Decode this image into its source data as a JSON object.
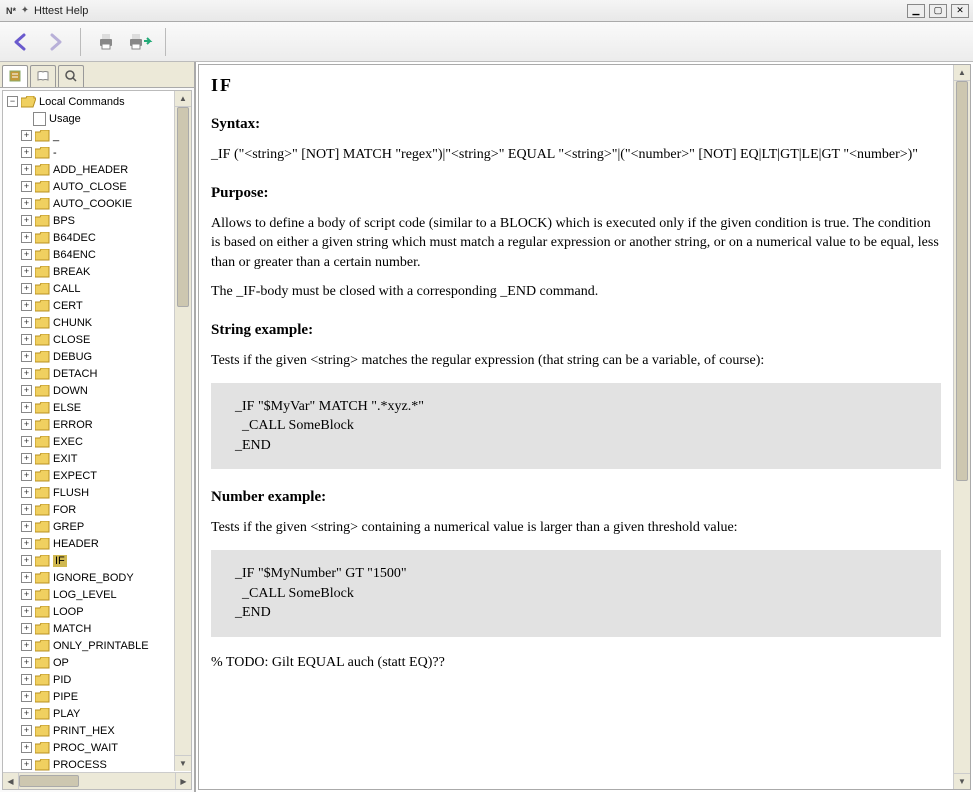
{
  "window": {
    "app_icon_text": "N*",
    "title": "Httest Help"
  },
  "toolbar": {
    "back": "back-arrow-icon",
    "forward": "forward-arrow-icon",
    "print": "print-icon",
    "print_preview": "print-preview-icon"
  },
  "sidebar": {
    "tabs": {
      "contents": "contents-tab",
      "index": "index-tab",
      "search": "search-tab"
    },
    "root": {
      "label": "Local Commands",
      "expanded": true
    },
    "usage": {
      "label": "Usage"
    },
    "items": [
      {
        "label": "_"
      },
      {
        "label": "-"
      },
      {
        "label": "ADD_HEADER"
      },
      {
        "label": "AUTO_CLOSE"
      },
      {
        "label": "AUTO_COOKIE"
      },
      {
        "label": "BPS"
      },
      {
        "label": "B64DEC"
      },
      {
        "label": "B64ENC"
      },
      {
        "label": "BREAK"
      },
      {
        "label": "CALL"
      },
      {
        "label": "CERT"
      },
      {
        "label": "CHUNK"
      },
      {
        "label": "CLOSE"
      },
      {
        "label": "DEBUG"
      },
      {
        "label": "DETACH"
      },
      {
        "label": "DOWN"
      },
      {
        "label": "ELSE"
      },
      {
        "label": "ERROR"
      },
      {
        "label": "EXEC"
      },
      {
        "label": "EXIT"
      },
      {
        "label": "EXPECT"
      },
      {
        "label": "FLUSH"
      },
      {
        "label": "FOR"
      },
      {
        "label": "GREP"
      },
      {
        "label": "HEADER"
      },
      {
        "label": "IF",
        "selected": true
      },
      {
        "label": "IGNORE_BODY"
      },
      {
        "label": "LOG_LEVEL"
      },
      {
        "label": "LOOP"
      },
      {
        "label": "MATCH"
      },
      {
        "label": "ONLY_PRINTABLE"
      },
      {
        "label": "OP"
      },
      {
        "label": "PID"
      },
      {
        "label": "PIPE"
      },
      {
        "label": "PLAY"
      },
      {
        "label": "PRINT_HEX"
      },
      {
        "label": "PROC_WAIT"
      },
      {
        "label": "PROCESS"
      }
    ]
  },
  "doc": {
    "title": "IF",
    "syntax_h": "Syntax:",
    "syntax_body": "_IF (\"<string>\" [NOT] MATCH \"regex\")|\"<string>\" EQUAL \"<string>\"|(\"<number>\" [NOT] EQ|LT|GT|LE|GT \"<number>)\"",
    "purpose_h": "Purpose:",
    "purpose_p1": "Allows to define a body of script code (similar to a BLOCK) which is executed only if the given condition is true. The condition is based on either a given string which must match a regular expression or another string, or on a numerical value to be equal, less than or greater than a certain number.",
    "purpose_p2": "The _IF-body must be closed with a corresponding _END command.",
    "string_h": "String example:",
    "string_p": "Tests if the given <string> matches the regular expression (that string can be a variable, of course):",
    "string_code": "_IF \"$MyVar\" MATCH \".*xyz.*\"\n  _CALL SomeBlock\n_END",
    "number_h": "Number example:",
    "number_p": "Tests if the given <string> containing a numerical value is larger than a given threshold value:",
    "number_code": "_IF \"$MyNumber\" GT \"1500\"\n  _CALL SomeBlock\n_END",
    "todo": "% TODO: Gilt EQUAL auch (statt EQ)??"
  }
}
